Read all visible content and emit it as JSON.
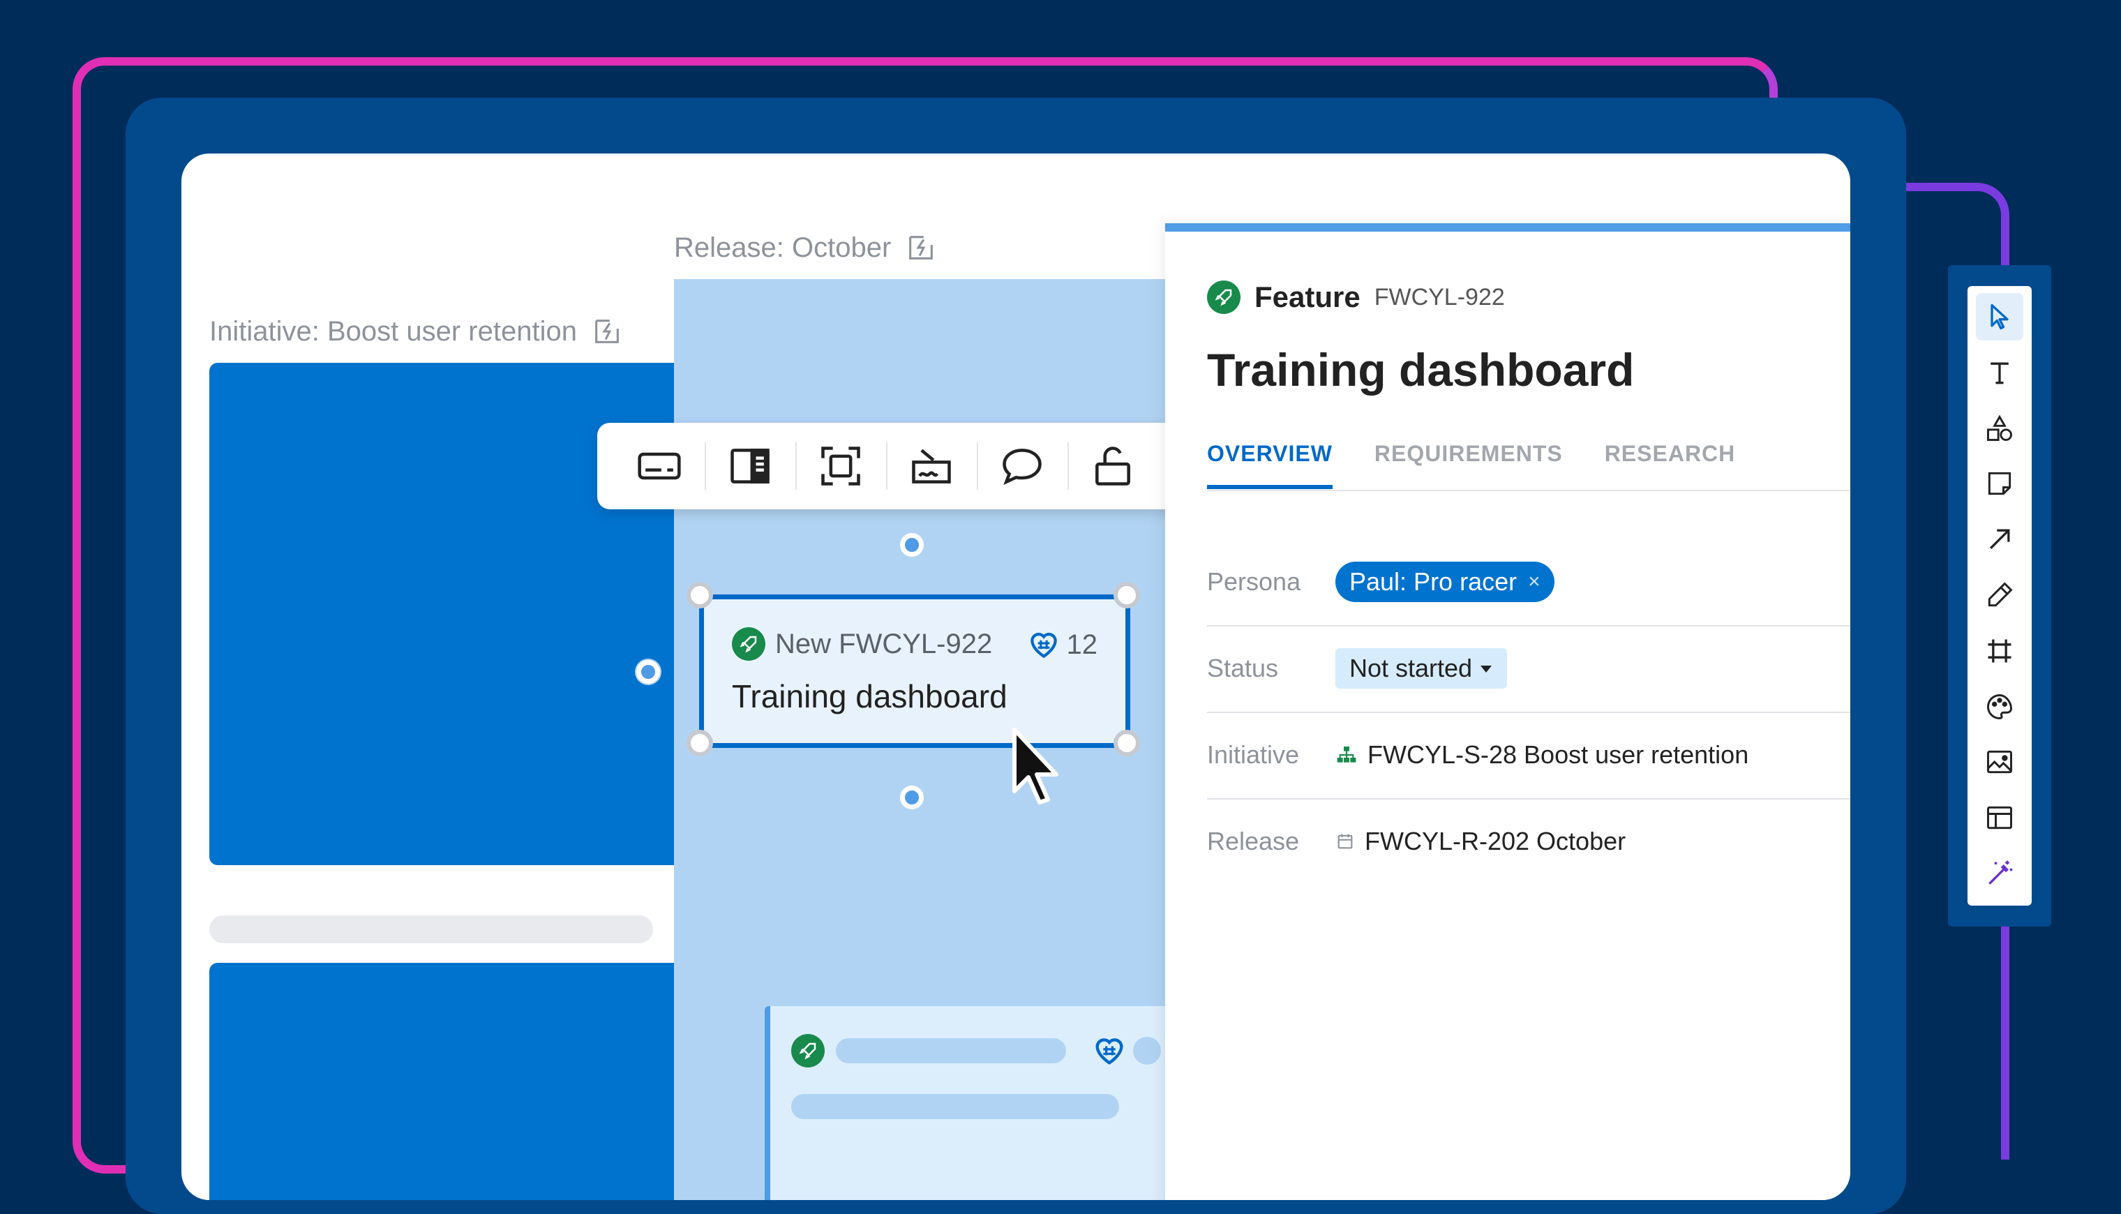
{
  "canvas": {
    "initiative_frame_label": "Initiative: Boost user retention",
    "release_frame_label": "Release: October"
  },
  "selected_card": {
    "key": "New FWCYL-922",
    "score": "12",
    "title": "Training dashboard"
  },
  "feature_panel": {
    "record_type": "Feature",
    "record_key": "FWCYL-922",
    "title": "Training dashboard",
    "tabs": [
      {
        "label": "OVERVIEW",
        "active": true
      },
      {
        "label": "REQUIREMENTS",
        "active": false
      },
      {
        "label": "RESEARCH",
        "active": false
      }
    ],
    "fields": {
      "persona": {
        "label": "Persona",
        "value": "Paul: Pro racer",
        "remove_glyph": "×"
      },
      "status": {
        "label": "Status",
        "value": "Not started"
      },
      "initiative": {
        "label": "Initiative",
        "value": "FWCYL-S-28 Boost user retention"
      },
      "release": {
        "label": "Release",
        "value": "FWCYL-R-202 October"
      }
    }
  },
  "colors": {
    "background": "#002c5a",
    "accent": "#0069c8",
    "feature_green": "#188a4b",
    "frame_pink": "#e02fb5",
    "frame_purple": "#7a3be0"
  },
  "card_toolbar": [
    "card-icon",
    "panel-icon",
    "focus-icon",
    "sign-icon",
    "comment-icon",
    "unlock-icon"
  ],
  "right_toolbar": [
    "pointer-icon",
    "text-icon",
    "shapes-icon",
    "sticky-note-icon",
    "arrow-icon",
    "pen-icon",
    "frame-icon",
    "palette-icon",
    "image-icon",
    "layout-icon",
    "ai-magic-icon"
  ]
}
